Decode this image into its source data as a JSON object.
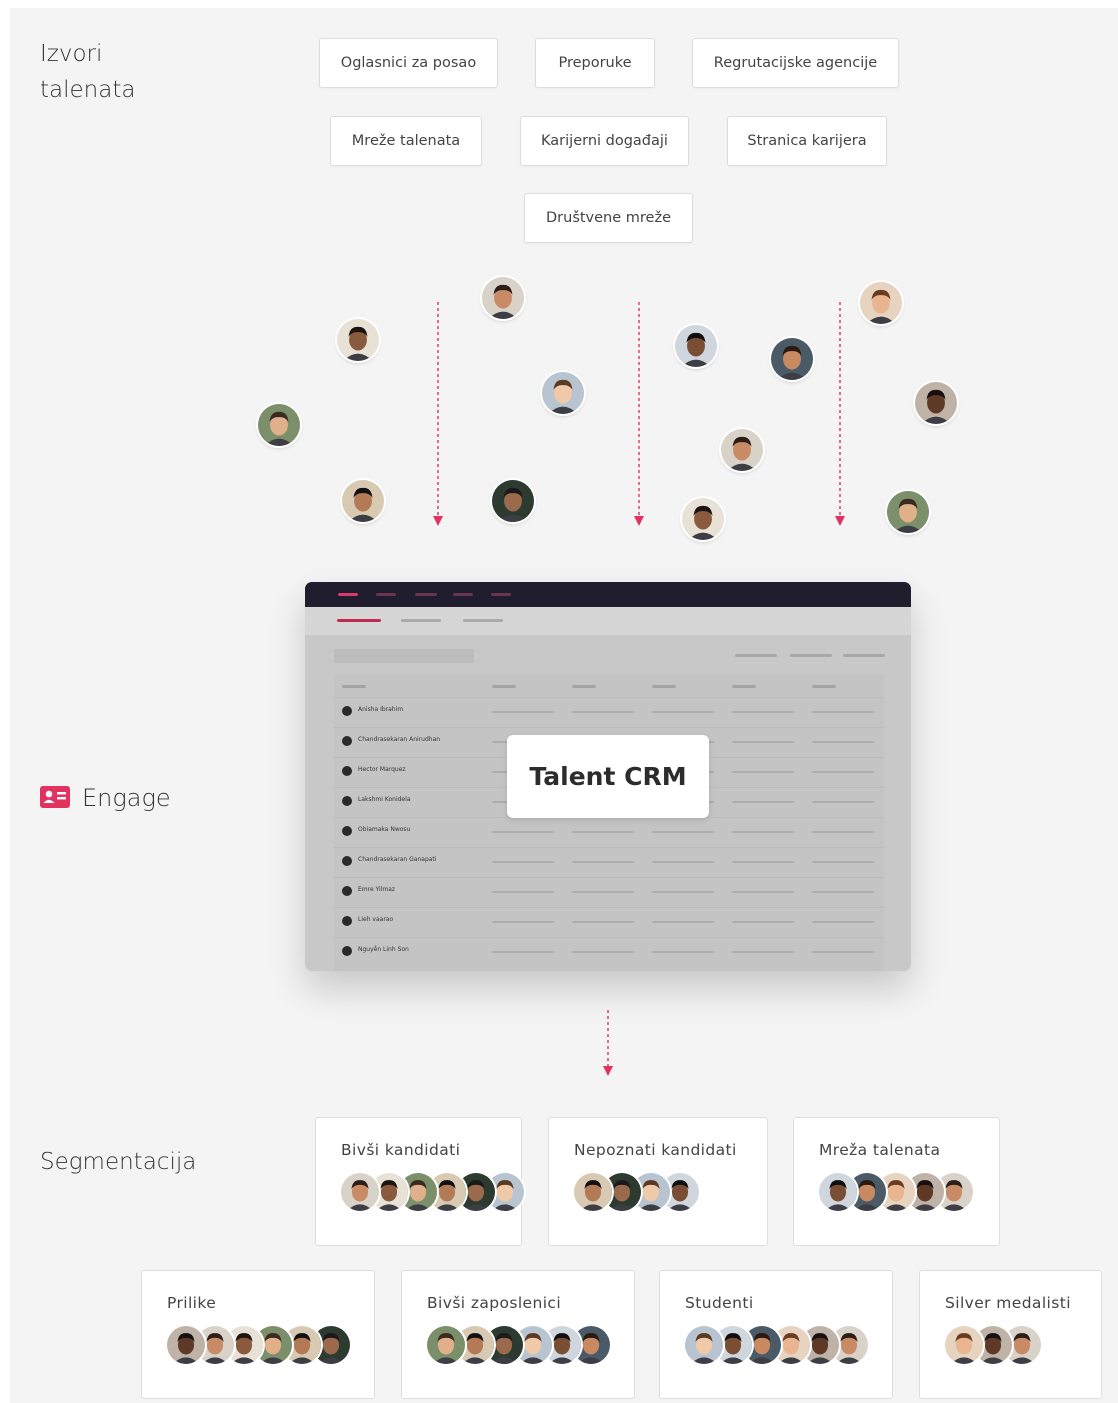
{
  "sources": {
    "label": "Izvori\ntalenata",
    "chips": [
      "Oglasnici za posao",
      "Preporuke",
      "Regrutacijske agencije",
      "Mreže talenata",
      "Karijerni događaji",
      "Stranica karijera",
      "Društvene mreže"
    ]
  },
  "engage": {
    "icon": "contact-card-icon",
    "label": "Engage",
    "accent": "#e2325f"
  },
  "crm": {
    "label": "Talent CRM",
    "rows": [
      "Anisha Ibrahim",
      "Chandrasekaran Anirudhan",
      "Hector Marquez",
      "Lakshmi Konidela",
      "Obiamaka Nwosu",
      "Chandrasekaran Ganapati",
      "Emre Yilmaz",
      "Lieh vaarao",
      "Nguyễn Linh Son"
    ]
  },
  "segmentation": {
    "label": "Segmentacija",
    "cards": [
      {
        "title": "Bivši kandidati",
        "avatars": 6
      },
      {
        "title": "Nepoznati kandidati",
        "avatars": 4
      },
      {
        "title": "Mreža talenata",
        "avatars": 5
      },
      {
        "title": "Prilike",
        "avatars": 6
      },
      {
        "title": "Bivši zaposlenici",
        "avatars": 6
      },
      {
        "title": "Studenti",
        "avatars": 6
      },
      {
        "title": "Silver medalisti",
        "avatars": 3
      }
    ]
  },
  "colors": {
    "arrow": "#e2325f",
    "background": "#f4f4f4",
    "crm_topbar": "#1f1d2e"
  }
}
